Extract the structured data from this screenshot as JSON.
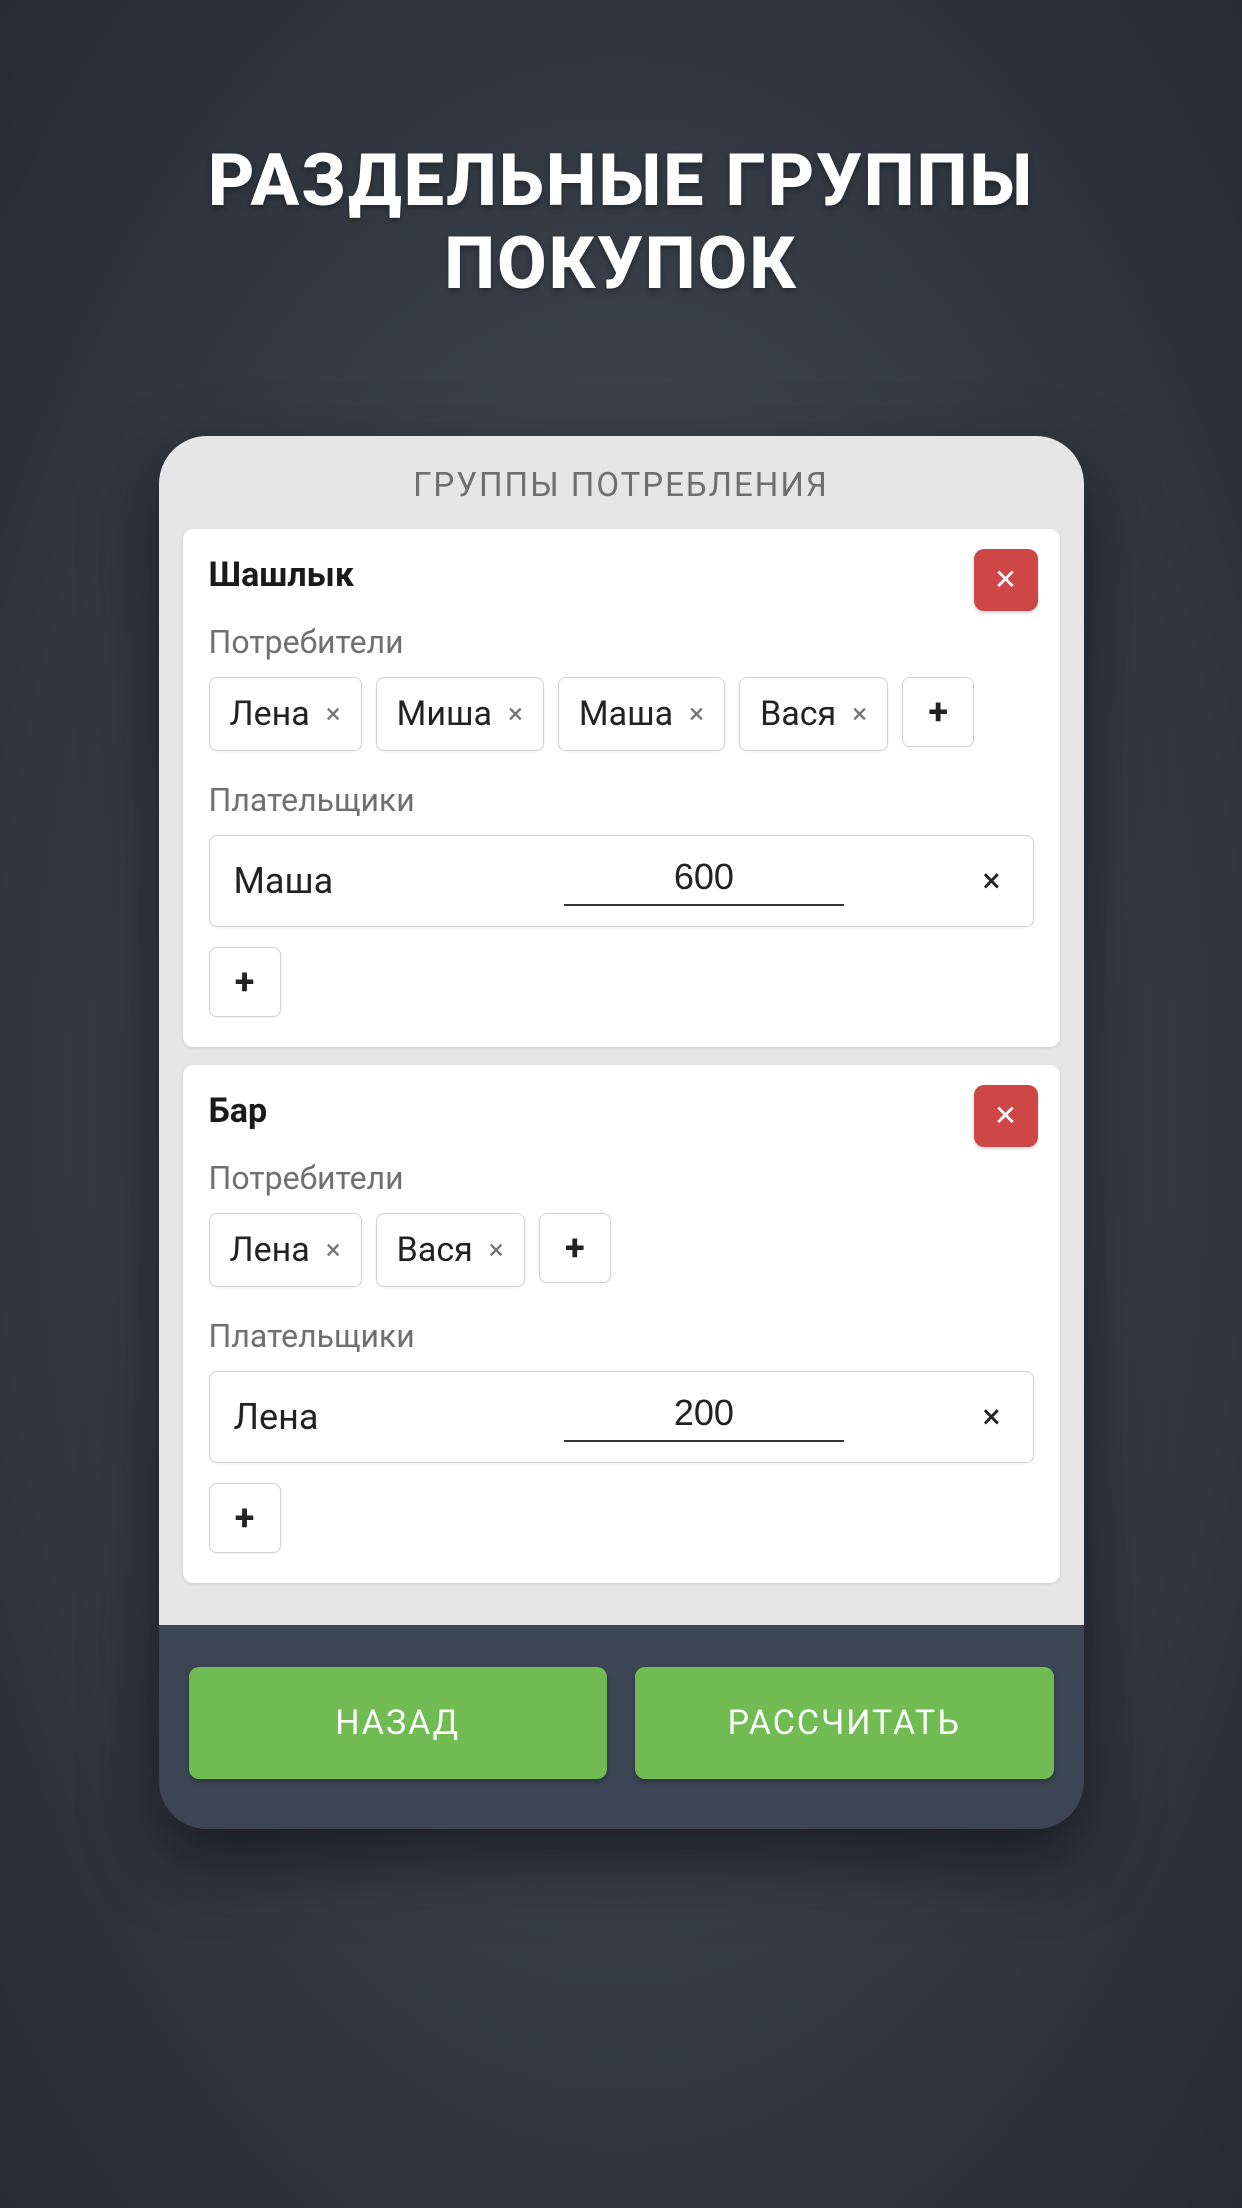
{
  "headline_line1": "РАЗДЕЛЬНЫЕ ГРУППЫ",
  "headline_line2": "ПОКУПОК",
  "screen_title": "ГРУППЫ ПОТРЕБЛЕНИЯ",
  "labels": {
    "consumers": "Потребители",
    "payers": "Плательщики"
  },
  "groups": [
    {
      "title": "Шашлык",
      "consumers": [
        "Лена",
        "Миша",
        "Маша",
        "Вася"
      ],
      "payers": [
        {
          "name": "Маша",
          "amount": "600"
        }
      ]
    },
    {
      "title": "Бар",
      "consumers": [
        "Лена",
        "Вася"
      ],
      "payers": [
        {
          "name": "Лена",
          "amount": "200"
        }
      ]
    }
  ],
  "buttons": {
    "back": "НАЗАД",
    "calculate": "РАССЧИТАТЬ"
  },
  "glyphs": {
    "close": "✕",
    "plus": "+",
    "times": "×"
  }
}
